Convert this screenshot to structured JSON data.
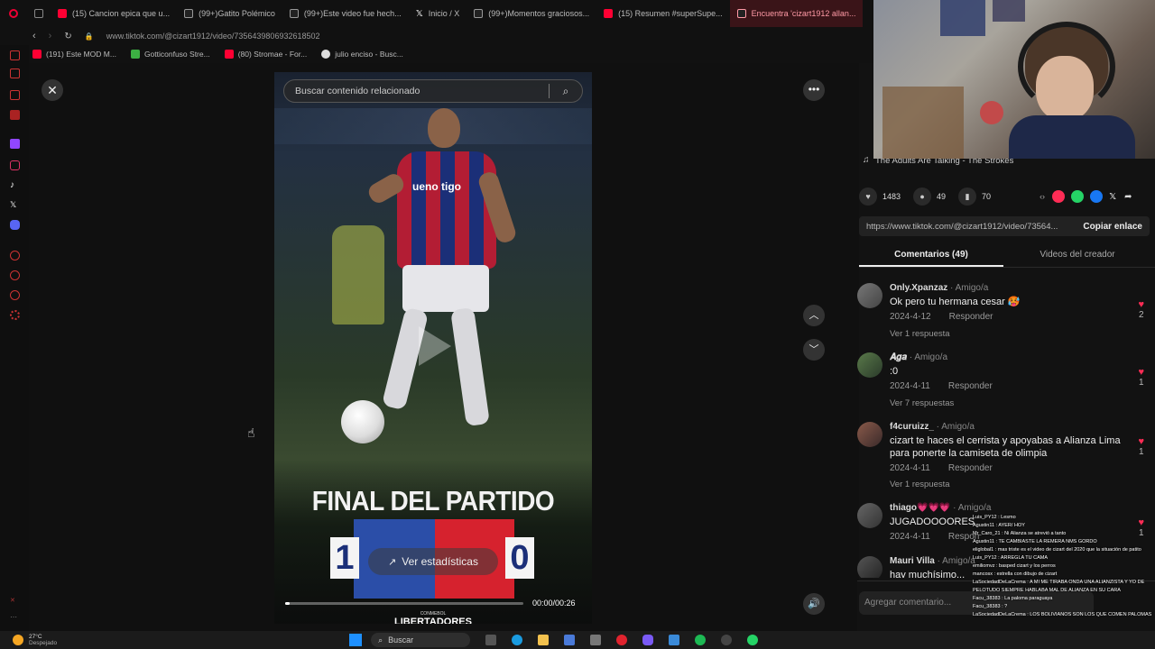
{
  "browser": {
    "tabs": [
      {
        "label": "(15) Cancion epica que u...",
        "color": "#ff0033"
      },
      {
        "label": "(99+)Gatito Polémico",
        "color": "#ffffff"
      },
      {
        "label": "(99+)Este video fue hech...",
        "color": "#ffffff"
      },
      {
        "label": "Inicio / X",
        "color": "#ffffff"
      },
      {
        "label": "(99+)Momentos graciosos...",
        "color": "#ffffff"
      },
      {
        "label": "(15) Resumen #superSupe...",
        "color": "#ff0033"
      },
      {
        "label": "Encuentra 'cizart1912 allan...",
        "color": "#ff2c55"
      }
    ],
    "url": "www.tiktok.com/@cizart1912/video/7356439806932618502",
    "bookmarks": [
      {
        "label": "(191) Este MOD M...",
        "color": "#ff0033"
      },
      {
        "label": "Gotticonfuso Stre...",
        "color": "#3cb043"
      },
      {
        "label": "(80) Stromae - For...",
        "color": "#ff0033"
      },
      {
        "label": "julio enciso - Busc...",
        "color": "#dddddd"
      }
    ]
  },
  "video": {
    "search_placeholder": "Buscar contenido relacionado",
    "final_text": "FINAL DEL PARTIDO",
    "score_left": "1",
    "score_right": "0",
    "stats_button": "Ver estadísticas",
    "time": "00:00/00:26",
    "league_small": "CONMEBOL",
    "league": "LIBERTADORES",
    "jersey_text": "ueno tigo",
    "progress": 0.02
  },
  "panel": {
    "song": "The Adults Are Talking - The Strokes",
    "likes": "1483",
    "comments_count": "49",
    "saves": "70",
    "share_url": "https://www.tiktok.com/@cizart1912/video/73564...",
    "copy_link": "Copiar enlace",
    "tab_comments": "Comentarios (49)",
    "tab_creator": "Videos del creador",
    "add_comment": "Agregar comentario...",
    "comments": [
      {
        "user": "Only.Xpanzaz",
        "rel": " · Amigo/a",
        "text": "Ok pero tu hermana cesar 🥵",
        "date": "2024-4-12",
        "reply": "Responder",
        "replies": "Ver 1 respuesta",
        "likes": "2"
      },
      {
        "user": "𝑨𝒈𝒂",
        "rel": " · Amigo/a",
        "text": ":0",
        "date": "2024-4-11",
        "reply": "Responder",
        "replies": "Ver 7 respuestas",
        "likes": "1"
      },
      {
        "user": "f4curuizz_",
        "rel": " · Amigo/a",
        "text": "cizart te haces el cerrista y apoyabas a Alianza Lima para ponerte la camiseta de olimpia",
        "date": "2024-4-11",
        "reply": "Responder",
        "replies": "Ver 1 respuesta",
        "likes": "1"
      },
      {
        "user": "thiago💗💗💗",
        "rel": " · Amigo/a",
        "text": "JUGADOOOORES",
        "date": "2024-4-11",
        "reply": "Respon",
        "replies": "",
        "likes": "1"
      },
      {
        "user": "Mauri Villa",
        "rel": " · Amigo/a",
        "text": "hay muchísimo...",
        "date": "",
        "reply": "",
        "replies": "",
        "likes": ""
      }
    ]
  },
  "taskbar": {
    "weather_temp": "27°C",
    "weather_desc": "Despejado",
    "search": "Buscar"
  },
  "chat_overlay": [
    "Luis_PY12 : Lesmo",
    "Agustin11 : AYER/ HOY",
    "Mr_Caro_21 : Ni Alianza se atrevió a tanto",
    "Agustin11 : TE CAMBIASTE LA REMERA NMS GORDO",
    "eliglobal1 : mas triste es el video de cizart del 2020 que la situación de patito",
    "Luis_PY12 : ARREGLA TU CAMA",
    "emiliomvz : basped cizart y los perros",
    "mancosx : estrella con dibujo de cizart",
    "LaSociedadDeLaCrema : A MI ME TIRABA ONDA UNA ALIANZISTA Y YO DE PELOTUDO SIEMPRE HABLABA MAL DE ALIANZA EN SU CARA",
    "Facu_38383 : La paloma paraguaya",
    "Facu_38383 : ?",
    "LaSociedadDeLaCrema : LOS BOLIVIANOS SON LOS QUE COMEN PALOMAS"
  ]
}
